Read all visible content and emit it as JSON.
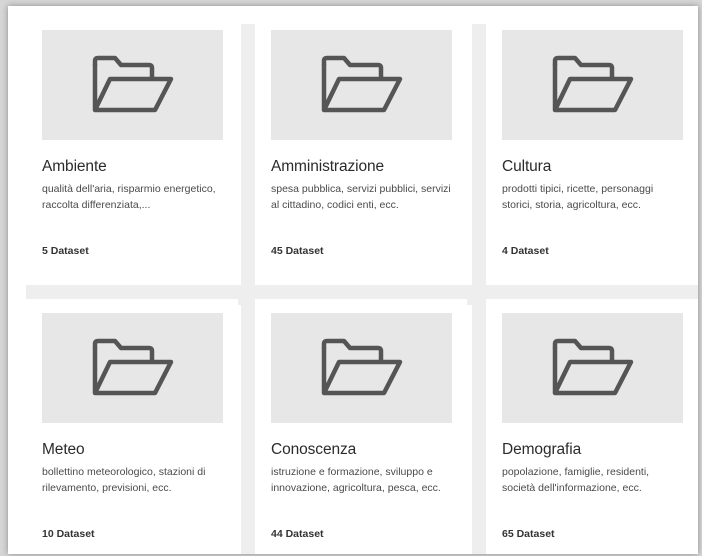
{
  "categories": [
    {
      "icon": "folder-icon",
      "title": "Ambiente",
      "description": "qualità dell'aria, risparmio energetico, raccolta differenziata,...",
      "count": "5 Dataset"
    },
    {
      "icon": "folder-icon",
      "title": "Amministrazione",
      "description": "spesa pubblica, servizi pubblici, servizi al cittadino, codici enti, ecc.",
      "count": "45 Dataset"
    },
    {
      "icon": "folder-icon",
      "title": "Cultura",
      "description": "prodotti tipici, ricette, personaggi storici, storia, agricoltura, ecc.",
      "count": "4 Dataset"
    },
    {
      "icon": "folder-icon",
      "title": "Meteo",
      "description": "bollettino meteorologico, stazioni di rilevamento, previsioni, ecc.",
      "count": "10 Dataset"
    },
    {
      "icon": "folder-icon",
      "title": "Conoscenza",
      "description": "istruzione e formazione, sviluppo e innovazione, agricoltura, pesca, ecc.",
      "count": "44 Dataset"
    },
    {
      "icon": "folder-icon",
      "title": "Demografia",
      "description": "popolazione, famiglie, residenti, società dell'informazione, ecc.",
      "count": "65 Dataset"
    }
  ],
  "colors": {
    "thumb_background": "#e7e7e7",
    "icon_stroke": "#555555",
    "separator": "#eeeeee"
  }
}
